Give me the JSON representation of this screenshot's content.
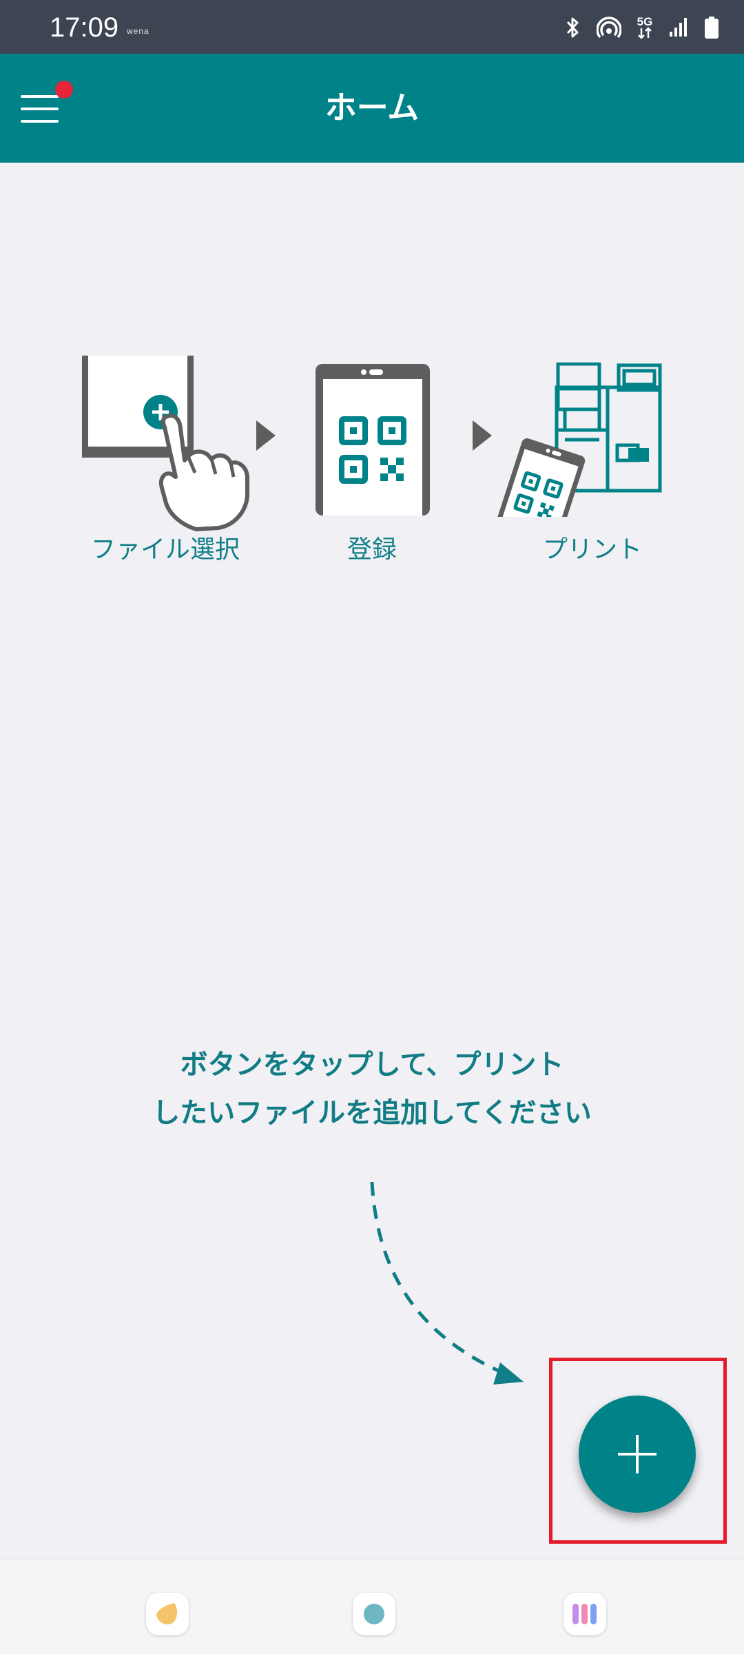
{
  "status_bar": {
    "time": "17:09",
    "carrier_note": "wena",
    "network_label": "5G",
    "icons": [
      "bluetooth-icon",
      "hotspot-icon",
      "network-5g-icon",
      "signal-icon",
      "battery-icon"
    ]
  },
  "app_bar": {
    "title": "ホーム",
    "menu_icon": "hamburger-menu-icon",
    "has_notification_badge": true
  },
  "steps": [
    {
      "label": "ファイル選択",
      "icon": "file-select-tap-icon"
    },
    {
      "label": "登録",
      "icon": "phone-qr-code-icon"
    },
    {
      "label": "プリント",
      "icon": "printer-with-phone-icon"
    }
  ],
  "instruction": {
    "line1": "ボタンをタップして、プリント",
    "line2": "したいファイルを追加してください"
  },
  "fab": {
    "icon": "plus-icon",
    "highlighted": true
  },
  "dock": {
    "items": [
      "yellow-app-icon",
      "teal-dot-app-icon",
      "multicolor-app-icon"
    ]
  },
  "colors": {
    "primary": "#008289",
    "status_bar": "#3d4452",
    "background": "#f1f1f5",
    "label_text": "#0f7e86",
    "badge": "#e5263a",
    "highlight": "#e41b2a"
  }
}
